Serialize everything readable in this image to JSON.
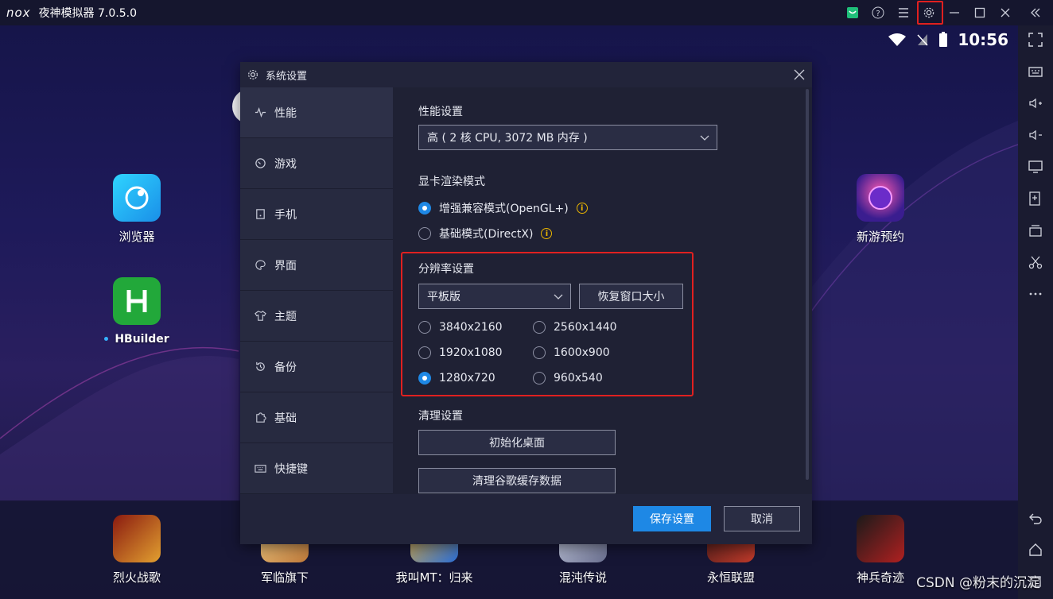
{
  "titlebar": {
    "logo": "nox",
    "title": "夜神模拟器 7.0.5.0",
    "icons": [
      "store-icon",
      "help-icon",
      "menu-icon",
      "gear-icon",
      "minimize-icon",
      "maximize-icon",
      "close-icon",
      "collapse-icon"
    ]
  },
  "statusbar": {
    "time": "10:56"
  },
  "desktop": {
    "apps": [
      {
        "label": "浏览器"
      },
      {
        "label": "HBuilder"
      },
      {
        "label": "新游预约"
      }
    ],
    "dock": [
      {
        "label": "烈火战歌"
      },
      {
        "label": "军临旗下"
      },
      {
        "label": "我叫MT：归来"
      },
      {
        "label": "混沌传说"
      },
      {
        "label": "永恒联盟"
      },
      {
        "label": "神兵奇迹"
      }
    ]
  },
  "dialog": {
    "title": "系统设置",
    "nav": [
      {
        "label": "性能",
        "icon": "pulse-icon",
        "active": true
      },
      {
        "label": "游戏",
        "icon": "game-icon"
      },
      {
        "label": "手机",
        "icon": "phone-icon"
      },
      {
        "label": "界面",
        "icon": "palette-icon"
      },
      {
        "label": "主题",
        "icon": "shirt-icon"
      },
      {
        "label": "备份",
        "icon": "restore-icon"
      },
      {
        "label": "基础",
        "icon": "puzzle-icon"
      },
      {
        "label": "快捷键",
        "icon": "keyboard-icon"
      }
    ],
    "performance": {
      "title": "性能设置",
      "selected": "高 ( 2 核 CPU, 3072 MB 内存 )"
    },
    "render": {
      "title": "显卡渲染模式",
      "options": [
        {
          "label": "增强兼容模式(OpenGL+)",
          "checked": true
        },
        {
          "label": "基础模式(DirectX)",
          "checked": false
        }
      ]
    },
    "resolution": {
      "title": "分辨率设置",
      "mode": "平板版",
      "restore_button": "恢复窗口大小",
      "options": [
        {
          "label": "3840x2160",
          "checked": false
        },
        {
          "label": "2560x1440",
          "checked": false
        },
        {
          "label": "1920x1080",
          "checked": false
        },
        {
          "label": "1600x900",
          "checked": false
        },
        {
          "label": "1280x720",
          "checked": true
        },
        {
          "label": "960x540",
          "checked": false
        }
      ]
    },
    "cleanup": {
      "title": "清理设置",
      "init_button": "初始化桌面",
      "clear_button": "清理谷歌缓存数据"
    },
    "footer": {
      "save": "保存设置",
      "cancel": "取消"
    }
  },
  "watermark": "CSDN @粉末的沉淀",
  "colors": {
    "accent": "#1e88e5",
    "highlight": "#e02020",
    "warning": "#e8b400"
  }
}
